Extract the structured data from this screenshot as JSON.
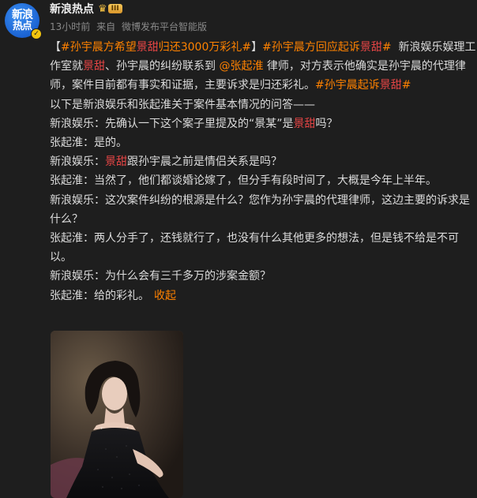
{
  "author": {
    "avatar_line1": "新浪",
    "avatar_line2": "热点",
    "name": "新浪热点",
    "level_badge": "III"
  },
  "meta": {
    "time": "13小时前",
    "source_prefix": "来自",
    "source": "微博发布平台智能版"
  },
  "post": {
    "bracket_open": "【",
    "tag1_a": "#孙宇晨方希望",
    "tag1_b": "景甜",
    "tag1_c": "归还3000万彩礼#",
    "bracket_close": "】",
    "tag2_a": "#孙宇晨方回应起诉",
    "tag2_b": "景甜",
    "tag2_c": "#",
    "p1_a": "新浪娱乐娱理工作室就",
    "p1_b": "景甜",
    "p1_c": "、孙宇晨的纠纷联系到",
    "mention": "@张起淮",
    "p1_d": "律师，对方表示他确实是孙宇晨的代理律师，案件目前都有事实和证据，主要诉求是归还彩礼。",
    "tag3_a": "#孙宇晨起诉",
    "tag3_b": "景甜",
    "tag3_c": "#",
    "intro": "以下是新浪娱乐和张起淮关于案件基本情况的问答——",
    "q1_a": "新浪娱乐：先确认一下这个案子里提及的“景某”是",
    "q1_b": "景甜",
    "q1_c": "吗？",
    "a1": "张起淮：是的。",
    "q2_a": "新浪娱乐：",
    "q2_b": "景甜",
    "q2_c": "跟孙宇晨之前是情侣关系是吗？",
    "a2": "张起淮：当然了，他们都谈婚论嫁了，但分手有段时间了，大概是今年上半年。",
    "q3": "新浪娱乐：这次案件纠纷的根源是什么？您作为孙宇晨的代理律师，这边主要的诉求是什么？",
    "a3": "张起淮：两人分手了，还钱就行了，也没有什么其他更多的想法，但是钱不给是不可以。",
    "q4": "新浪娱乐：为什么会有三千多万的涉案金额？",
    "a4": "张起淮：给的彩礼。",
    "collapse": "收起"
  },
  "colors": {
    "background": "#1e1e1e",
    "topic": "#ff8200",
    "keyword_highlight": "#e64545",
    "meta_text": "#8a8a8a"
  }
}
